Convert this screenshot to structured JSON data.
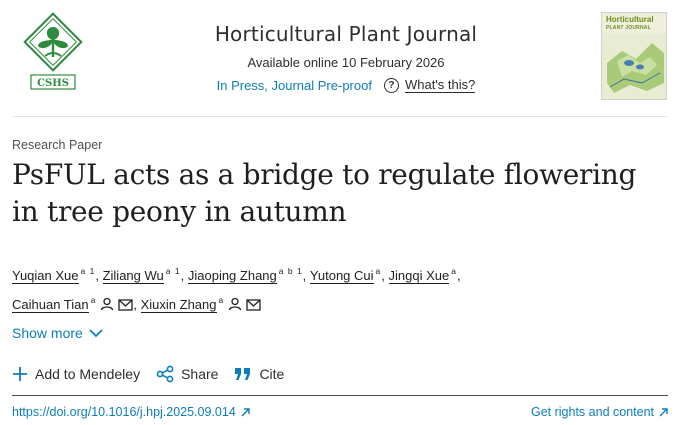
{
  "header": {
    "logo_text": "CSHS",
    "journal_title": "Horticultural Plant Journal",
    "available_online": "Available online 10 February 2026",
    "status_link": "In Press, Journal Pre-proof",
    "whats_this": "What's this?",
    "cover_title": "Horticultural",
    "cover_subtitle": "PLANT JOURNAL"
  },
  "article": {
    "type": "Research Paper",
    "title": "PsFUL acts as a bridge to regulate flowering in tree peony in autumn",
    "authors": [
      {
        "name": "Yuqian Xue",
        "sup": "a 1",
        "sep": ","
      },
      {
        "name": "Ziliang Wu",
        "sup": "a 1",
        "sep": ","
      },
      {
        "name": "Jiaoping Zhang",
        "sup": "a b 1",
        "sep": ","
      },
      {
        "name": "Yutong Cui",
        "sup": "a",
        "sep": ","
      },
      {
        "name": "Jingqi Xue",
        "sup": "a",
        "sep": ","
      },
      {
        "name": "Caihuan Tian",
        "sup": "a",
        "sep": ","
      },
      {
        "name": "Xiuxin Zhang",
        "sup": "a",
        "sep": ""
      }
    ],
    "show_more": "Show more",
    "actions": {
      "mendeley": "Add to Mendeley",
      "share": "Share",
      "cite": "Cite"
    },
    "doi": "https://doi.org/10.1016/j.hpj.2025.09.014",
    "rights": "Get rights and content"
  },
  "colors": {
    "link": "#0c7dbb",
    "logo_green": "#2e8b3d",
    "text": "#1f1f1f"
  }
}
